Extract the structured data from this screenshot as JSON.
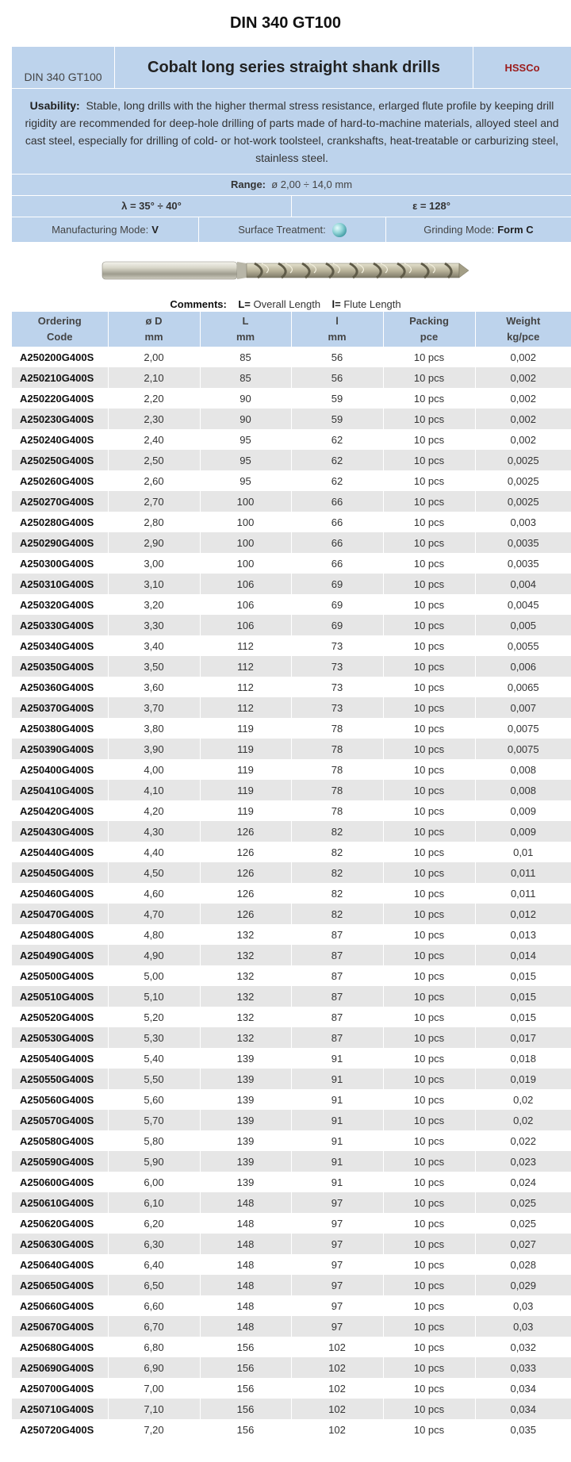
{
  "page_title": "DIN 340 GT100",
  "header": {
    "code": "DIN 340 GT100",
    "title": "Cobalt long series straight shank drills",
    "material": "HSSCo"
  },
  "usability": {
    "label": "Usability:",
    "text": "Stable, long drills with the higher thermal stress resistance, erlarged flute profile by keeping drill rigidity are recommended for deep-hole drilling of parts made of hard-to-machine materials, alloyed steel and cast steel, especially for drilling of cold- or hot-work toolsteel, crankshafts, heat-treatable or carburizing steel, stainless steel."
  },
  "range": {
    "label": "Range:",
    "value": "ø 2,00 ÷ 14,0 mm"
  },
  "angles": {
    "lambda": "λ = 35° ÷ 40°",
    "epsilon": "ε = 128°"
  },
  "modes": {
    "manufacturing_label": "Manufacturing Mode:",
    "manufacturing_value": "V",
    "surface_label": "Surface Treatment:",
    "surface_icon": "teal-ball-icon",
    "grinding_label": "Grinding Mode:",
    "grinding_value": "Form C"
  },
  "comments": {
    "label": "Comments:",
    "l_upper": "L=",
    "l_upper_text": "Overall Length",
    "l_lower": "l=",
    "l_lower_text": "Flute Length"
  },
  "table": {
    "headers": [
      [
        "Ordering",
        "Code"
      ],
      [
        "ø D",
        "mm"
      ],
      [
        "L",
        "mm"
      ],
      [
        "l",
        "mm"
      ],
      [
        "Packing",
        "pce"
      ],
      [
        "Weight",
        "kg/pce"
      ]
    ],
    "rows": [
      [
        "A250200G400S",
        "2,00",
        "85",
        "56",
        "10 pcs",
        "0,002"
      ],
      [
        "A250210G400S",
        "2,10",
        "85",
        "56",
        "10 pcs",
        "0,002"
      ],
      [
        "A250220G400S",
        "2,20",
        "90",
        "59",
        "10 pcs",
        "0,002"
      ],
      [
        "A250230G400S",
        "2,30",
        "90",
        "59",
        "10 pcs",
        "0,002"
      ],
      [
        "A250240G400S",
        "2,40",
        "95",
        "62",
        "10 pcs",
        "0,002"
      ],
      [
        "A250250G400S",
        "2,50",
        "95",
        "62",
        "10 pcs",
        "0,0025"
      ],
      [
        "A250260G400S",
        "2,60",
        "95",
        "62",
        "10 pcs",
        "0,0025"
      ],
      [
        "A250270G400S",
        "2,70",
        "100",
        "66",
        "10 pcs",
        "0,0025"
      ],
      [
        "A250280G400S",
        "2,80",
        "100",
        "66",
        "10 pcs",
        "0,003"
      ],
      [
        "A250290G400S",
        "2,90",
        "100",
        "66",
        "10 pcs",
        "0,0035"
      ],
      [
        "A250300G400S",
        "3,00",
        "100",
        "66",
        "10 pcs",
        "0,0035"
      ],
      [
        "A250310G400S",
        "3,10",
        "106",
        "69",
        "10 pcs",
        "0,004"
      ],
      [
        "A250320G400S",
        "3,20",
        "106",
        "69",
        "10 pcs",
        "0,0045"
      ],
      [
        "A250330G400S",
        "3,30",
        "106",
        "69",
        "10 pcs",
        "0,005"
      ],
      [
        "A250340G400S",
        "3,40",
        "112",
        "73",
        "10 pcs",
        "0,0055"
      ],
      [
        "A250350G400S",
        "3,50",
        "112",
        "73",
        "10 pcs",
        "0,006"
      ],
      [
        "A250360G400S",
        "3,60",
        "112",
        "73",
        "10 pcs",
        "0,0065"
      ],
      [
        "A250370G400S",
        "3,70",
        "112",
        "73",
        "10 pcs",
        "0,007"
      ],
      [
        "A250380G400S",
        "3,80",
        "119",
        "78",
        "10 pcs",
        "0,0075"
      ],
      [
        "A250390G400S",
        "3,90",
        "119",
        "78",
        "10 pcs",
        "0,0075"
      ],
      [
        "A250400G400S",
        "4,00",
        "119",
        "78",
        "10 pcs",
        "0,008"
      ],
      [
        "A250410G400S",
        "4,10",
        "119",
        "78",
        "10 pcs",
        "0,008"
      ],
      [
        "A250420G400S",
        "4,20",
        "119",
        "78",
        "10 pcs",
        "0,009"
      ],
      [
        "A250430G400S",
        "4,30",
        "126",
        "82",
        "10 pcs",
        "0,009"
      ],
      [
        "A250440G400S",
        "4,40",
        "126",
        "82",
        "10 pcs",
        "0,01"
      ],
      [
        "A250450G400S",
        "4,50",
        "126",
        "82",
        "10 pcs",
        "0,011"
      ],
      [
        "A250460G400S",
        "4,60",
        "126",
        "82",
        "10 pcs",
        "0,011"
      ],
      [
        "A250470G400S",
        "4,70",
        "126",
        "82",
        "10 pcs",
        "0,012"
      ],
      [
        "A250480G400S",
        "4,80",
        "132",
        "87",
        "10 pcs",
        "0,013"
      ],
      [
        "A250490G400S",
        "4,90",
        "132",
        "87",
        "10 pcs",
        "0,014"
      ],
      [
        "A250500G400S",
        "5,00",
        "132",
        "87",
        "10 pcs",
        "0,015"
      ],
      [
        "A250510G400S",
        "5,10",
        "132",
        "87",
        "10 pcs",
        "0,015"
      ],
      [
        "A250520G400S",
        "5,20",
        "132",
        "87",
        "10 pcs",
        "0,015"
      ],
      [
        "A250530G400S",
        "5,30",
        "132",
        "87",
        "10 pcs",
        "0,017"
      ],
      [
        "A250540G400S",
        "5,40",
        "139",
        "91",
        "10 pcs",
        "0,018"
      ],
      [
        "A250550G400S",
        "5,50",
        "139",
        "91",
        "10 pcs",
        "0,019"
      ],
      [
        "A250560G400S",
        "5,60",
        "139",
        "91",
        "10 pcs",
        "0,02"
      ],
      [
        "A250570G400S",
        "5,70",
        "139",
        "91",
        "10 pcs",
        "0,02"
      ],
      [
        "A250580G400S",
        "5,80",
        "139",
        "91",
        "10 pcs",
        "0,022"
      ],
      [
        "A250590G400S",
        "5,90",
        "139",
        "91",
        "10 pcs",
        "0,023"
      ],
      [
        "A250600G400S",
        "6,00",
        "139",
        "91",
        "10 pcs",
        "0,024"
      ],
      [
        "A250610G400S",
        "6,10",
        "148",
        "97",
        "10 pcs",
        "0,025"
      ],
      [
        "A250620G400S",
        "6,20",
        "148",
        "97",
        "10 pcs",
        "0,025"
      ],
      [
        "A250630G400S",
        "6,30",
        "148",
        "97",
        "10 pcs",
        "0,027"
      ],
      [
        "A250640G400S",
        "6,40",
        "148",
        "97",
        "10 pcs",
        "0,028"
      ],
      [
        "A250650G400S",
        "6,50",
        "148",
        "97",
        "10 pcs",
        "0,029"
      ],
      [
        "A250660G400S",
        "6,60",
        "148",
        "97",
        "10 pcs",
        "0,03"
      ],
      [
        "A250670G400S",
        "6,70",
        "148",
        "97",
        "10 pcs",
        "0,03"
      ],
      [
        "A250680G400S",
        "6,80",
        "156",
        "102",
        "10 pcs",
        "0,032"
      ],
      [
        "A250690G400S",
        "6,90",
        "156",
        "102",
        "10 pcs",
        "0,033"
      ],
      [
        "A250700G400S",
        "7,00",
        "156",
        "102",
        "10 pcs",
        "0,034"
      ],
      [
        "A250710G400S",
        "7,10",
        "156",
        "102",
        "10 pcs",
        "0,034"
      ],
      [
        "A250720G400S",
        "7,20",
        "156",
        "102",
        "10 pcs",
        "0,035"
      ]
    ]
  },
  "colors": {
    "panel_bg": "#bdd3ec",
    "stripe_bg": "#e6e6e6",
    "brand_red": "#9b1b1b"
  }
}
